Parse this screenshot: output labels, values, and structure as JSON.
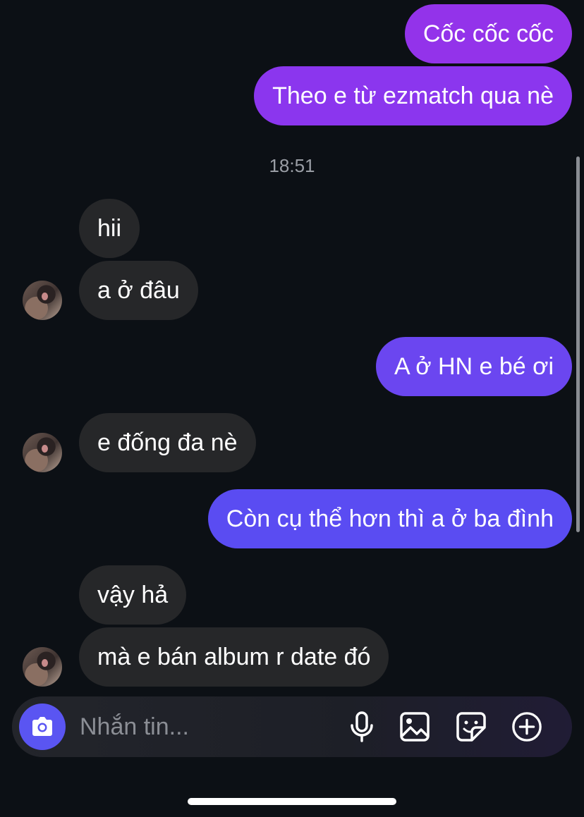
{
  "chat": {
    "messages": [
      {
        "dir": "out",
        "text": "Cốc cốc cốc",
        "color": "#9333ea"
      },
      {
        "dir": "out",
        "text": "Theo e từ ezmatch qua nè",
        "color": "#8b36ee"
      },
      {
        "dir": "in",
        "text": "hii"
      },
      {
        "dir": "in",
        "text": "a ở đâu"
      },
      {
        "dir": "out",
        "text": "A ở HN e bé ơi",
        "color": "#6b46f0"
      },
      {
        "dir": "in",
        "text": "e đống đa nè"
      },
      {
        "dir": "out",
        "text": "Còn cụ thể hơn thì a ở ba đình",
        "color": "#5a4cf2"
      },
      {
        "dir": "in",
        "text": "vậy hả"
      },
      {
        "dir": "in",
        "text": "mà e bán album r date đó"
      }
    ],
    "timestamp": "18:51"
  },
  "composer": {
    "placeholder": "Nhắn tin...",
    "icons": [
      "camera-icon",
      "microphone-icon",
      "image-icon",
      "sticker-icon",
      "plus-icon"
    ]
  },
  "colors": {
    "background": "#0c1015",
    "incoming_bubble": "#262729",
    "camera_button": "#5a55f2"
  }
}
